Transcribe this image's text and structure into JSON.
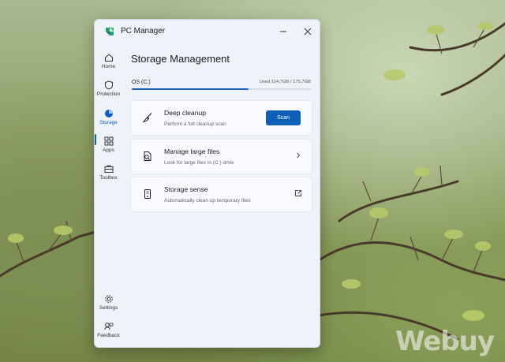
{
  "app": {
    "title": "PC Manager"
  },
  "sidebar": {
    "items": [
      {
        "label": "Home",
        "icon": "home-icon"
      },
      {
        "label": "Protection",
        "icon": "shield-icon"
      },
      {
        "label": "Storage",
        "icon": "pie-chart-icon",
        "active": true
      },
      {
        "label": "Apps",
        "icon": "apps-grid-icon"
      },
      {
        "label": "Toolbox",
        "icon": "toolbox-icon"
      }
    ],
    "bottom_items": [
      {
        "label": "Settings",
        "icon": "gear-icon"
      },
      {
        "label": "Feedback",
        "icon": "feedback-icon"
      }
    ]
  },
  "main": {
    "title": "Storage Management",
    "drive": {
      "name": "OS (C:)",
      "used_text": "Used 114,7GB / 175,7GB",
      "used_fraction": 0.653
    },
    "cards": [
      {
        "title": "Deep cleanup",
        "subtitle": "Perform a full cleanup scan",
        "action_label": "Scan"
      },
      {
        "title": "Manage large files",
        "subtitle": "Look for large files in (C:) drive"
      },
      {
        "title": "Storage sense",
        "subtitle": "Automatically clean up temporary files"
      }
    ]
  },
  "watermark": "Webuy",
  "colors": {
    "accent": "#0f5fb8",
    "window_bg": "#eef3fa",
    "card_bg": "#f8fafd"
  }
}
